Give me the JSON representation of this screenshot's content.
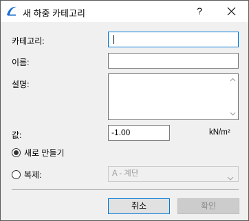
{
  "window": {
    "title": "새 하중 카테고리",
    "help_label": "?",
    "icon": "archicad-app-icon"
  },
  "form": {
    "category_label": "카테고리:",
    "category_value": "",
    "name_label": "이름:",
    "name_value": "",
    "description_label": "설명:",
    "description_value": "",
    "value_label": "값:",
    "value_value": "-1.00",
    "unit": "kN/m²"
  },
  "options": {
    "new_label": "새로 만들기",
    "new_selected": true,
    "duplicate_label": "복제:",
    "duplicate_selected": false,
    "duplicate_source": "A - 계단"
  },
  "buttons": {
    "cancel": "취소",
    "ok": "확인"
  },
  "colors": {
    "focus_accent": "#0078d7",
    "icon_blue": "#1f6fd6"
  }
}
